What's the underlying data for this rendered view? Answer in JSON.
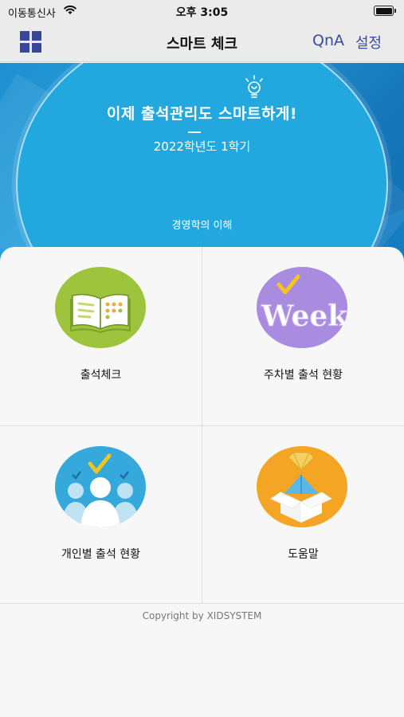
{
  "status_bar": {
    "carrier": "이동통신사",
    "time": "오후 3:05"
  },
  "nav": {
    "title": "스마트 체크",
    "qna_label": "QnA",
    "settings_label": "설정"
  },
  "banner": {
    "headline": "이제 출석관리도 스마트하게!",
    "semester": "2022학년도 1학기",
    "course": "경영학의 이해"
  },
  "menu": {
    "items": [
      {
        "label": "출석체크",
        "icon": "book-icon",
        "color": "#9dc43c"
      },
      {
        "label": "주차별 출석 현황",
        "icon": "week-icon",
        "color": "#a98be0",
        "icon_text": "Week"
      },
      {
        "label": "개인별 출석 현황",
        "icon": "people-check-icon",
        "color": "#35a8dc"
      },
      {
        "label": "도움말",
        "icon": "help-box-icon",
        "color": "#f5a524"
      }
    ]
  },
  "footer": {
    "copyright": "Copyright by XIDSYSTEM"
  }
}
